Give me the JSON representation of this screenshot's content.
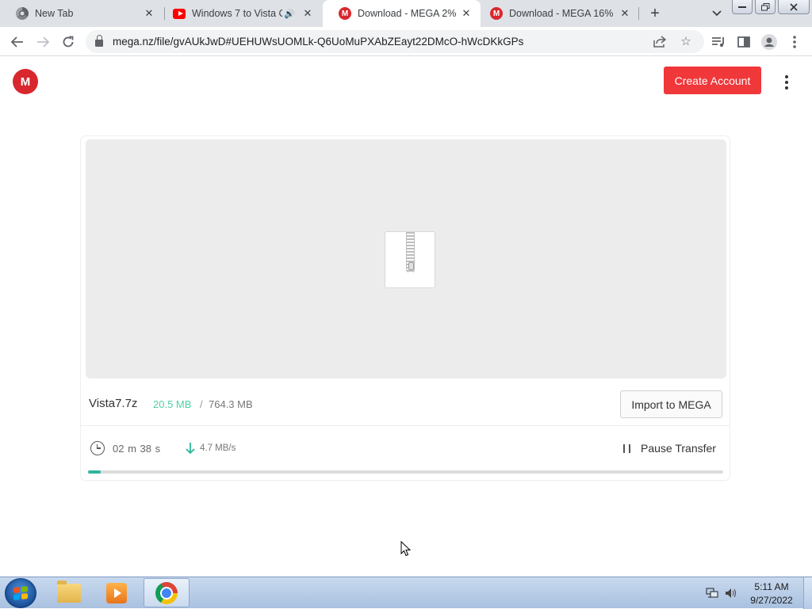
{
  "browser": {
    "tabs": [
      {
        "title": "New Tab",
        "favicon": "chrome-icon",
        "active": false
      },
      {
        "title": "Windows 7 to Vista C",
        "favicon": "youtube-icon",
        "audio": true,
        "active": false
      },
      {
        "title": "Download - MEGA 2%",
        "favicon": "mega-icon",
        "active": true
      },
      {
        "title": "Download - MEGA 16%",
        "favicon": "mega-icon",
        "active": false
      }
    ],
    "url": "mega.nz/file/gvAUkJwD#UEHUWsUOMLk-Q6UoMuPXAbZEayt22DMcO-hWcDKkGPs"
  },
  "page": {
    "logo_letter": "M",
    "create_account_label": "Create Account",
    "file": {
      "name": "Vista7.7z",
      "downloaded": "20.5 MB",
      "separator": "/",
      "total": "764.3 MB"
    },
    "import_label": "Import to MEGA",
    "time_remaining": "02 m  38 s",
    "speed": "4.7 MB/s",
    "pause_label": "Pause Transfer",
    "progress_percent": 2
  },
  "taskbar": {
    "clock_time": "5:11 AM",
    "clock_date": "9/27/2022"
  },
  "colors": {
    "mega_red": "#d9272e",
    "create_button": "#f0373a",
    "downloaded_text": "#4fd1a5",
    "progress_fill": "#2bb69a"
  }
}
